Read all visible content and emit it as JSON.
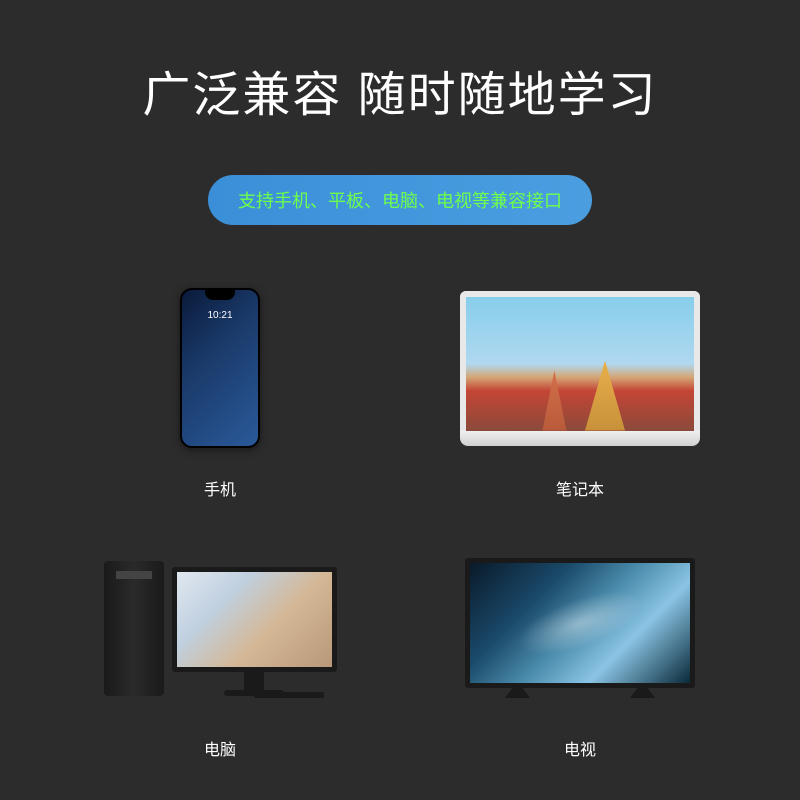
{
  "title": "广泛兼容  随时随地学习",
  "subtitle": "支持手机、平板、电脑、电视等兼容接口",
  "devices": [
    {
      "label": "手机"
    },
    {
      "label": "笔记本"
    },
    {
      "label": "电脑"
    },
    {
      "label": "电视"
    }
  ]
}
